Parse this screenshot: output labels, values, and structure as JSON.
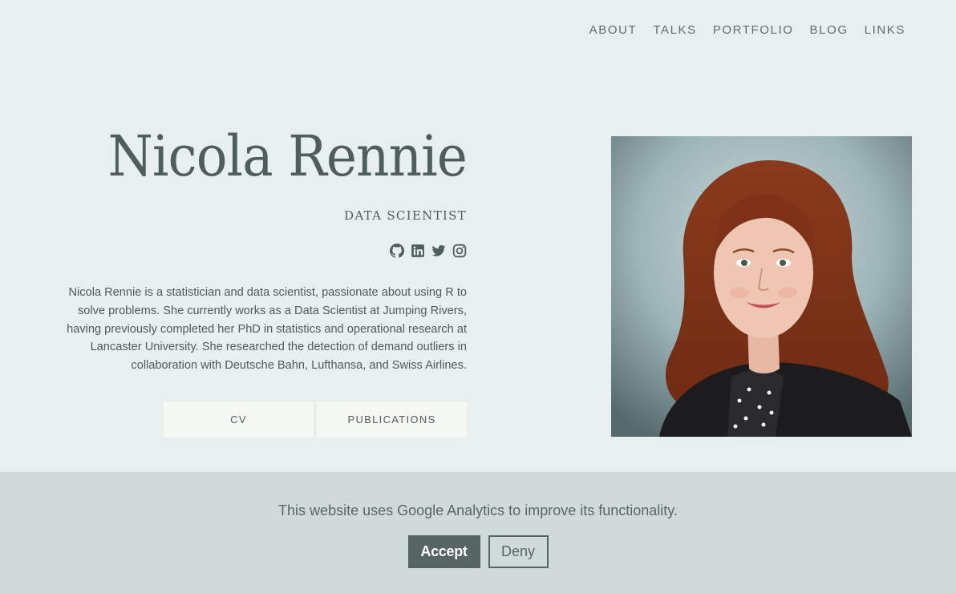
{
  "nav": {
    "items": [
      {
        "label": "ABOUT"
      },
      {
        "label": "TALKS"
      },
      {
        "label": "PORTFOLIO"
      },
      {
        "label": "BLOG"
      },
      {
        "label": "LINKS"
      }
    ]
  },
  "hero": {
    "name": "Nicola Rennie",
    "role": "DATA SCIENTIST",
    "social_icons": [
      "github-icon",
      "linkedin-icon",
      "twitter-icon",
      "instagram-icon"
    ],
    "bio": "Nicola Rennie is a statistician and data scientist, passionate about using R to solve problems. She currently works as a Data Scientist at Jumping Rivers, having previously completed her PhD in statistics and operational research at Lancaster University. She researched the detection of demand outliers in collaboration with Deutsche Bahn, Lufthansa, and Swiss Airlines.",
    "buttons": {
      "cv_label": "CV",
      "publications_label": "PUBLICATIONS"
    }
  },
  "cookie_banner": {
    "message": "This website uses Google Analytics to improve its functionality.",
    "accept_label": "Accept",
    "deny_label": "Deny"
  },
  "colors": {
    "background": "#e8f0ef",
    "text": "#4f5d5b",
    "button_bg": "#f5f7f3",
    "banner_bg": "#d0dad9",
    "accept_bg": "#566463"
  }
}
